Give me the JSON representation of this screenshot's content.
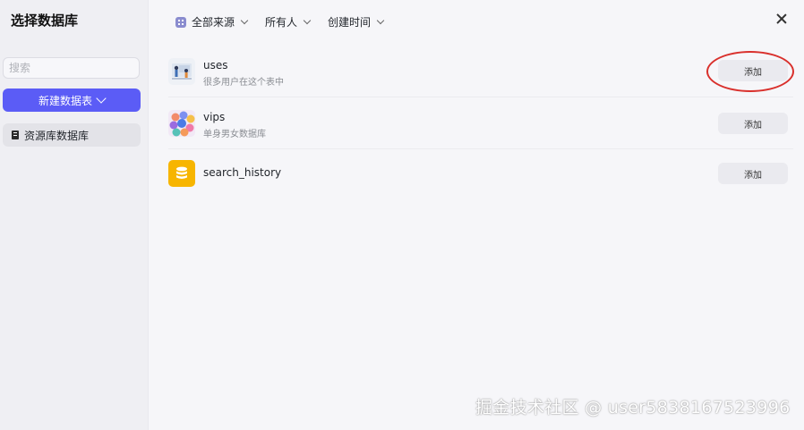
{
  "sidebar": {
    "title": "选择数据库",
    "search_placeholder": "搜索",
    "new_table_label": "新建数据表",
    "items": [
      {
        "label": "资源库数据库",
        "icon": "database-book-icon"
      }
    ]
  },
  "filters": [
    {
      "label": "全部来源",
      "icon": "grid-icon"
    },
    {
      "label": "所有人"
    },
    {
      "label": "创建时间"
    }
  ],
  "databases": [
    {
      "name": "uses",
      "description": "很多用户在这个表中",
      "icon": "illustration-thumbnail",
      "add_label": "添加"
    },
    {
      "name": "vips",
      "description": "单身男女数据库",
      "icon": "avatars-thumbnail",
      "add_label": "添加"
    },
    {
      "name": "search_history",
      "description": "",
      "icon": "database-icon",
      "add_label": "添加"
    }
  ],
  "colors": {
    "accent": "#5b5cf6",
    "highlight": "#d9302c",
    "db_icon_bg": "#f7b500"
  },
  "watermark": "掘金技术社区 @ user5838167523996"
}
